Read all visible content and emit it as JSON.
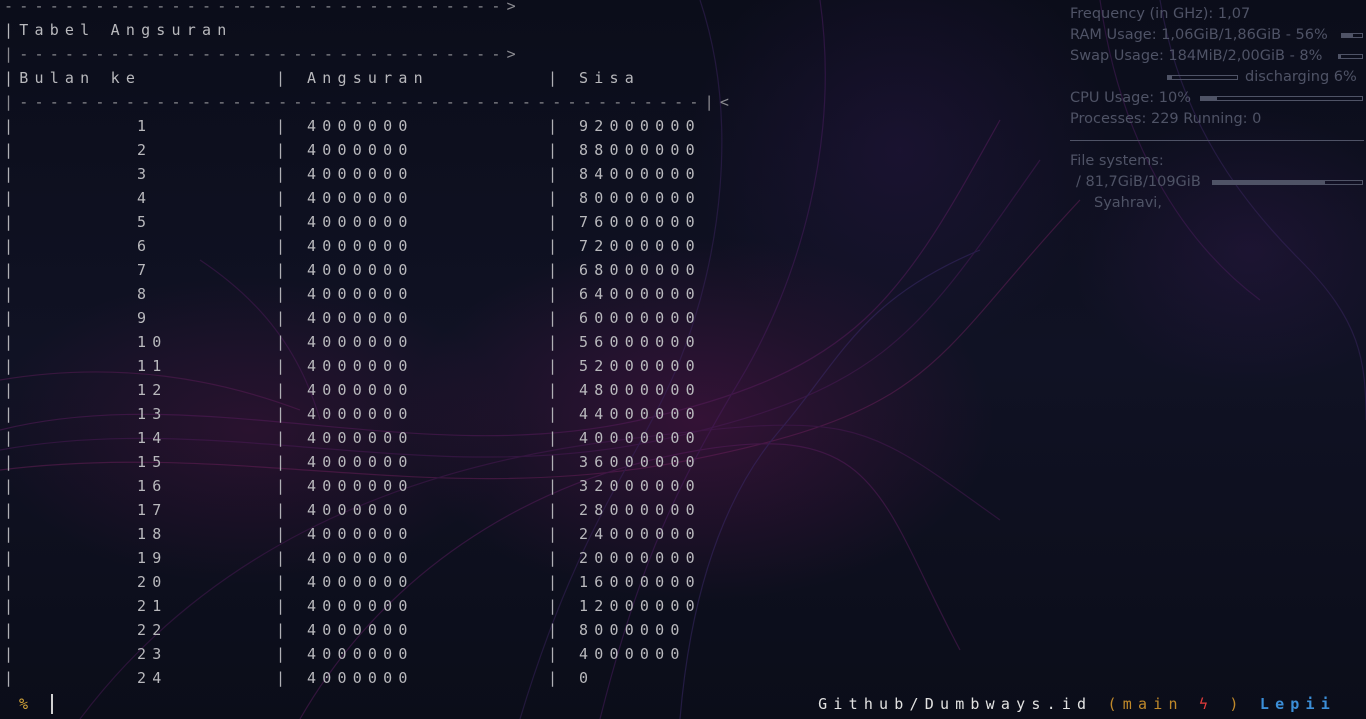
{
  "terminal": {
    "arrow_line_1": "--------------------------------->",
    "title_line": "|Tabel Angsuran",
    "arrow_line_2": "|-------------------------------->",
    "headers": {
      "bulan": "|Bulan ke",
      "angsuran": "Angsuran",
      "sisa": "Sisa"
    },
    "divider_line": "|---------------------------------------------|<",
    "rows": [
      {
        "bulan": "1",
        "angsuran": "4000000",
        "sisa": "92000000"
      },
      {
        "bulan": "2",
        "angsuran": "4000000",
        "sisa": "88000000"
      },
      {
        "bulan": "3",
        "angsuran": "4000000",
        "sisa": "84000000"
      },
      {
        "bulan": "4",
        "angsuran": "4000000",
        "sisa": "80000000"
      },
      {
        "bulan": "5",
        "angsuran": "4000000",
        "sisa": "76000000"
      },
      {
        "bulan": "6",
        "angsuran": "4000000",
        "sisa": "72000000"
      },
      {
        "bulan": "7",
        "angsuran": "4000000",
        "sisa": "68000000"
      },
      {
        "bulan": "8",
        "angsuran": "4000000",
        "sisa": "64000000"
      },
      {
        "bulan": "9",
        "angsuran": "4000000",
        "sisa": "60000000"
      },
      {
        "bulan": "10",
        "angsuran": "4000000",
        "sisa": "56000000"
      },
      {
        "bulan": "11",
        "angsuran": "4000000",
        "sisa": "52000000"
      },
      {
        "bulan": "12",
        "angsuran": "4000000",
        "sisa": "48000000"
      },
      {
        "bulan": "13",
        "angsuran": "4000000",
        "sisa": "44000000"
      },
      {
        "bulan": "14",
        "angsuran": "4000000",
        "sisa": "40000000"
      },
      {
        "bulan": "15",
        "angsuran": "4000000",
        "sisa": "36000000"
      },
      {
        "bulan": "16",
        "angsuran": "4000000",
        "sisa": "32000000"
      },
      {
        "bulan": "17",
        "angsuran": "4000000",
        "sisa": "28000000"
      },
      {
        "bulan": "18",
        "angsuran": "4000000",
        "sisa": "24000000"
      },
      {
        "bulan": "19",
        "angsuran": "4000000",
        "sisa": "20000000"
      },
      {
        "bulan": "20",
        "angsuran": "4000000",
        "sisa": "16000000"
      },
      {
        "bulan": "21",
        "angsuran": "4000000",
        "sisa": "12000000"
      },
      {
        "bulan": "22",
        "angsuran": "4000000",
        "sisa": "8000000"
      },
      {
        "bulan": "23",
        "angsuran": "4000000",
        "sisa": "4000000"
      },
      {
        "bulan": "24",
        "angsuran": "4000000",
        "sisa": "0"
      }
    ]
  },
  "prompt": {
    "symbol": "%",
    "path": "Github/Dumbways.id",
    "branch_open": "(main",
    "bolt": "ϟ",
    "branch_close": ")",
    "user": "Lepii",
    "colors": {
      "symbol": "#d5a63a",
      "branch": "#c0892a",
      "bolt": "#e23b3b",
      "user": "#3b8ed8"
    }
  },
  "conky": {
    "frequency": "Frequency (in GHz): 1,07",
    "ram_usage": "RAM Usage: 1,06GiB/1,86GiB - 56%",
    "ram_percent": 56,
    "swap_usage": "Swap Usage: 184MiB/2,00GiB - 8%",
    "swap_percent": 8,
    "battery": "discharging 6%",
    "battery_percent": 6,
    "cpu_usage": "CPU Usage: 10%",
    "cpu_percent": 10,
    "processes": "Processes: 229  Running: 0",
    "file_systems_label": "File systems:",
    "root_fs": "/ 81,7GiB/109GiB",
    "root_fs_percent": 75,
    "user": "Syahravi,"
  }
}
